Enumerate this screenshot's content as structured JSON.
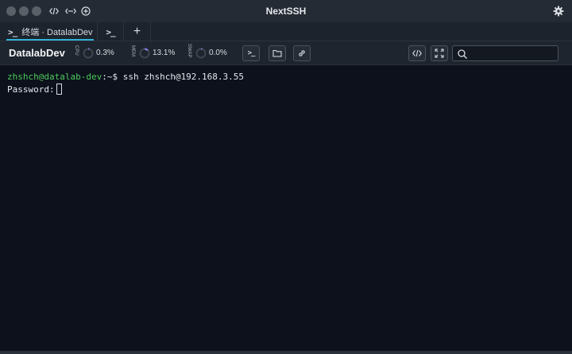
{
  "window": {
    "title": "NextSSH"
  },
  "titlebar": {
    "icons": [
      "code-icon",
      "network-icon",
      "plus-circle-icon"
    ],
    "settings_icon": "gear-icon"
  },
  "tabs": [
    {
      "label": "终端 · DatalabDev",
      "icon": "terminal-icon",
      "active": true
    },
    {
      "label": "",
      "icon": "terminal-icon",
      "active": false
    }
  ],
  "new_tab_label": "+",
  "toolbar": {
    "host": "DatalabDev",
    "stats": [
      {
        "label": "CPU",
        "value": "0.3%",
        "level": 0.003
      },
      {
        "label": "MEM",
        "value": "13.1%",
        "level": 0.131
      },
      {
        "label": "SWAP",
        "value": "0.0%",
        "level": 0.0
      }
    ],
    "buttons": [
      "terminal-icon",
      "folder-icon",
      "link-icon",
      "code-icon",
      "expand-icon"
    ],
    "search_placeholder": ""
  },
  "terminal": {
    "user_host": "zhshch@datalab-dev",
    "path_prompt": ":~$",
    "command": " ssh zhshch@192.168.3.55",
    "password_prompt": "Password:"
  },
  "colors": {
    "accent": "#30b3d9",
    "prompt_green": "#4ec95c",
    "terminal_bg": "#0c111c"
  }
}
